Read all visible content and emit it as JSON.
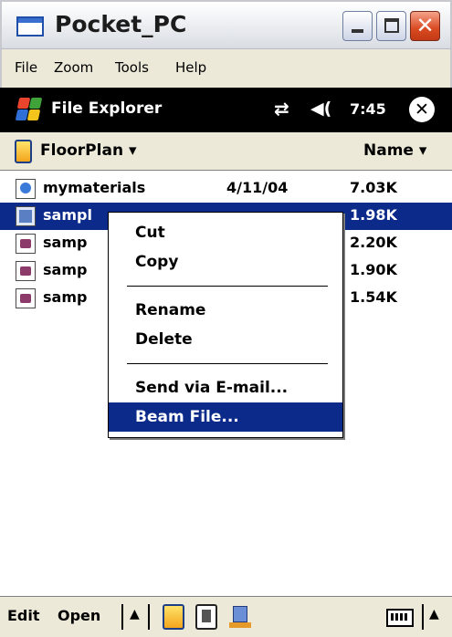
{
  "window": {
    "title": "Pocket_PC",
    "buttons": {
      "minimize": "_",
      "maximize": "□",
      "close": "✕"
    }
  },
  "host_menu": [
    "File",
    "Zoom",
    "Tools",
    "Help"
  ],
  "device_bar": {
    "app_title": "File Explorer",
    "time": "7:45",
    "connectivity_icon": "⇄",
    "volume_icon": "◀(",
    "close_icon": "✕",
    "logo_colors": [
      "#e8452c",
      "#3fa33a",
      "#2f6fd6",
      "#f3c51c"
    ]
  },
  "folder_bar": {
    "folder": "FloorPlan ▾",
    "sort": "Name ▾"
  },
  "files": [
    {
      "name": "mymaterials",
      "date": "4/11/04",
      "size": "7.03K",
      "icon": "web-page-icon",
      "selected": false
    },
    {
      "name": "sampl",
      "date": "",
      "size": "1.98K",
      "icon": "image-file-icon",
      "selected": true
    },
    {
      "name": "samp",
      "date": "",
      "size": "2.20K",
      "icon": "document-file-icon",
      "selected": false
    },
    {
      "name": "samp",
      "date": "",
      "size": "1.90K",
      "icon": "document-file-icon",
      "selected": false
    },
    {
      "name": "samp",
      "date": "",
      "size": "1.54K",
      "icon": "document-file-icon",
      "selected": false
    }
  ],
  "context_menu": {
    "cut": "Cut",
    "copy": "Copy",
    "rename": "Rename",
    "delete": "Delete",
    "send_email": "Send via E-mail...",
    "beam": "Beam File..."
  },
  "bottom_bar": {
    "edit": "Edit",
    "open": "Open",
    "up_arrow": "▲",
    "sip_arrow": "▲"
  },
  "colors": {
    "selection": "#0b2a8a",
    "device_bar": "#000000",
    "bar_background": "#ece9d8"
  }
}
